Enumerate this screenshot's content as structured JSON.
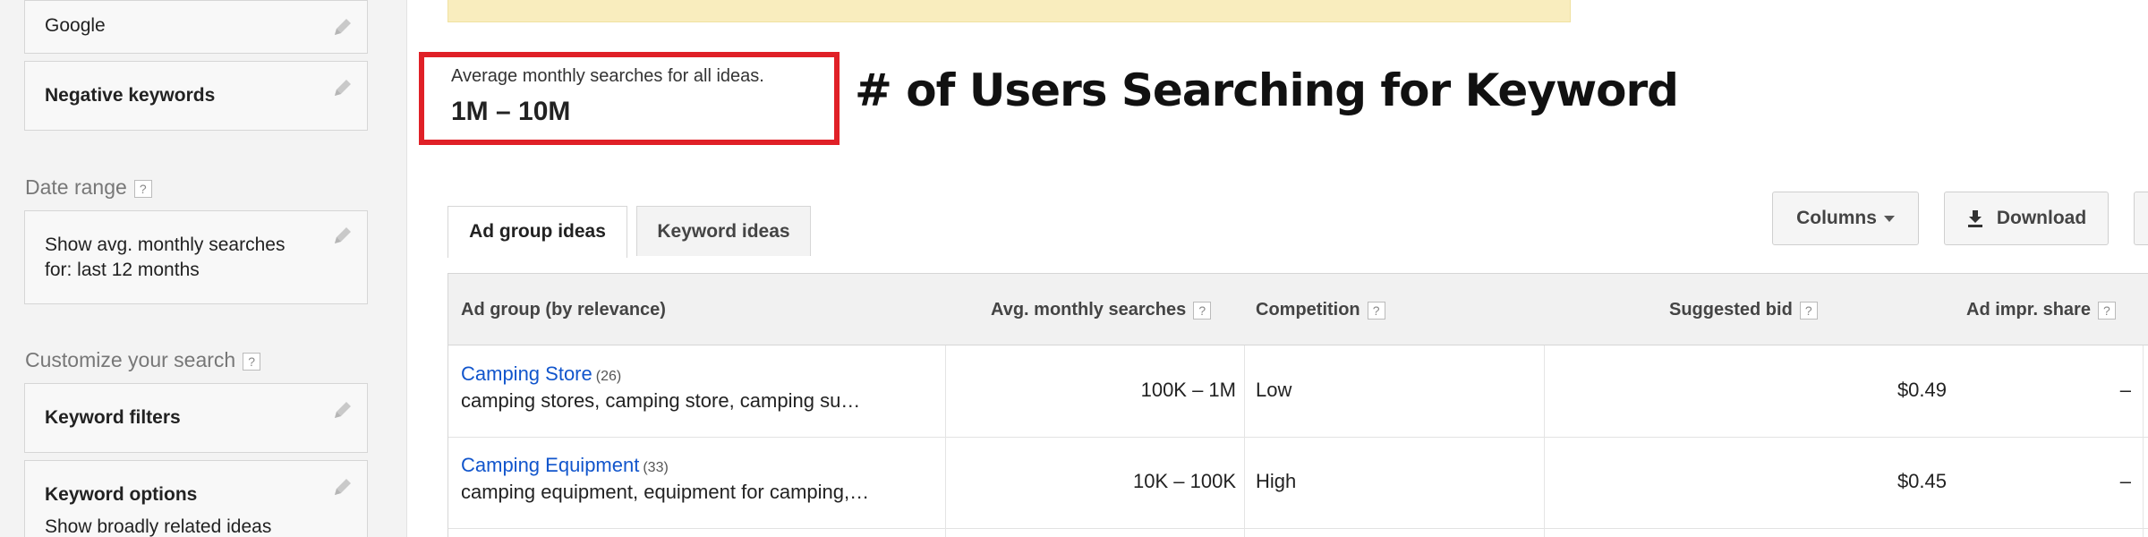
{
  "sidebar": {
    "network_value": "Google",
    "negative_keywords_label": "Negative keywords",
    "date_range_heading": "Date range",
    "date_range_line1": "Show avg. monthly searches",
    "date_range_line2": "for: last 12 months",
    "customize_heading": "Customize your search",
    "keyword_filters_label": "Keyword filters",
    "keyword_options_label": "Keyword options",
    "keyword_options_value": "Show broadly related ideas",
    "help_glyph": "?"
  },
  "summary": {
    "label": "Average monthly searches for all ideas.",
    "value": "1M – 10M"
  },
  "annotation": "# of Users Searching for Keyword",
  "tabs": [
    {
      "label": "Ad group ideas",
      "active": true
    },
    {
      "label": "Keyword ideas",
      "active": false
    }
  ],
  "toolbar": {
    "columns_label": "Columns",
    "download_label": "Download"
  },
  "table": {
    "headers": {
      "ad_group": "Ad group (by relevance)",
      "avg_searches": "Avg. monthly searches",
      "competition": "Competition",
      "suggested_bid": "Suggested bid",
      "ad_impr_share": "Ad impr. share"
    },
    "rows": [
      {
        "name": "Camping Store",
        "count": "(26)",
        "keywords": "camping stores, camping store, camping su…",
        "searches": "100K – 1M",
        "competition": "Low",
        "bid": "$0.49",
        "share": "–"
      },
      {
        "name": "Camping Equipment",
        "count": "(33)",
        "keywords": "camping equipment, equipment for camping,…",
        "searches": "10K – 100K",
        "competition": "High",
        "bid": "$0.45",
        "share": "–"
      }
    ]
  },
  "colors": {
    "highlight_border": "#e02027",
    "link": "#1155cc",
    "notice_bg": "#f9edbe"
  }
}
